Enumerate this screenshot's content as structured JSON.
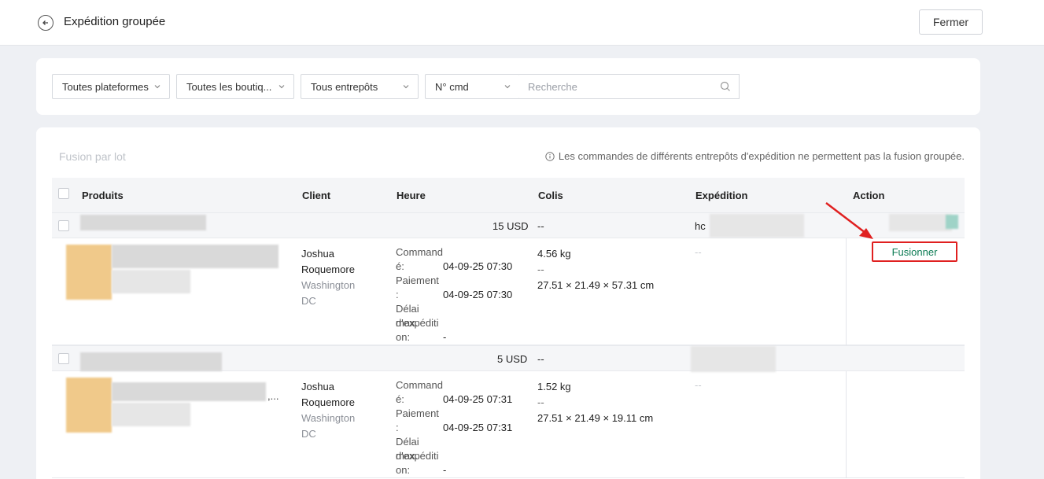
{
  "header": {
    "title": "Expédition groupée",
    "close_label": "Fermer"
  },
  "filters": {
    "platforms": "Toutes plateformes",
    "shops": "Toutes les boutiq...",
    "warehouses": "Tous entrepôts",
    "order_field": "N° cmd",
    "search_placeholder": "Recherche"
  },
  "main": {
    "batch_merge_label": "Fusion par lot",
    "notice": "Les commandes de différents entrepôts d'expédition ne permettent pas la fusion groupée."
  },
  "table": {
    "columns": [
      "Produits",
      "Client",
      "Heure",
      "Colis",
      "Expédition",
      "Action"
    ],
    "merge_action": "Fusionner",
    "groups": [
      {
        "total": "15 USD",
        "colis": "--",
        "shipping_prefix": "hc",
        "client_name_1": "Joshua",
        "client_name_2": "Roquemore",
        "client_loc_1": "Washington",
        "client_loc_2": "DC",
        "order_label_1": "Command",
        "order_label_2": "é:",
        "order_time": "04-09-25 07:30",
        "payment_label_1": "Paiement",
        "payment_label_2": ":",
        "payment_time": "04-09-25 07:30",
        "deadline_label_1": "Délai max.",
        "deadline_label_2": "d'expéditi",
        "deadline_label_3": "on:",
        "deadline_value": "-",
        "weight": "4.56 kg",
        "weight_extra": "--",
        "dimensions": "27.51 × 21.49 × 57.31 cm",
        "shipping": "--"
      },
      {
        "total": "5 USD",
        "colis": "--",
        "ellipsis": ",...",
        "client_name_1": "Joshua",
        "client_name_2": "Roquemore",
        "client_loc_1": "Washington",
        "client_loc_2": "DC",
        "order_label_1": "Command",
        "order_label_2": "é:",
        "order_time": "04-09-25 07:31",
        "payment_label_1": "Paiement",
        "payment_label_2": ":",
        "payment_time": "04-09-25 07:31",
        "deadline_label_1": "Délai max.",
        "deadline_label_2": "d'expéditi",
        "deadline_label_3": "on:",
        "deadline_value": "-",
        "weight": "1.52 kg",
        "weight_extra": "--",
        "dimensions": "27.51 × 21.49 × 19.11 cm",
        "shipping": "--"
      }
    ]
  },
  "colors": {
    "accent_green": "#0b7b53",
    "annotation_red": "#e02020"
  }
}
